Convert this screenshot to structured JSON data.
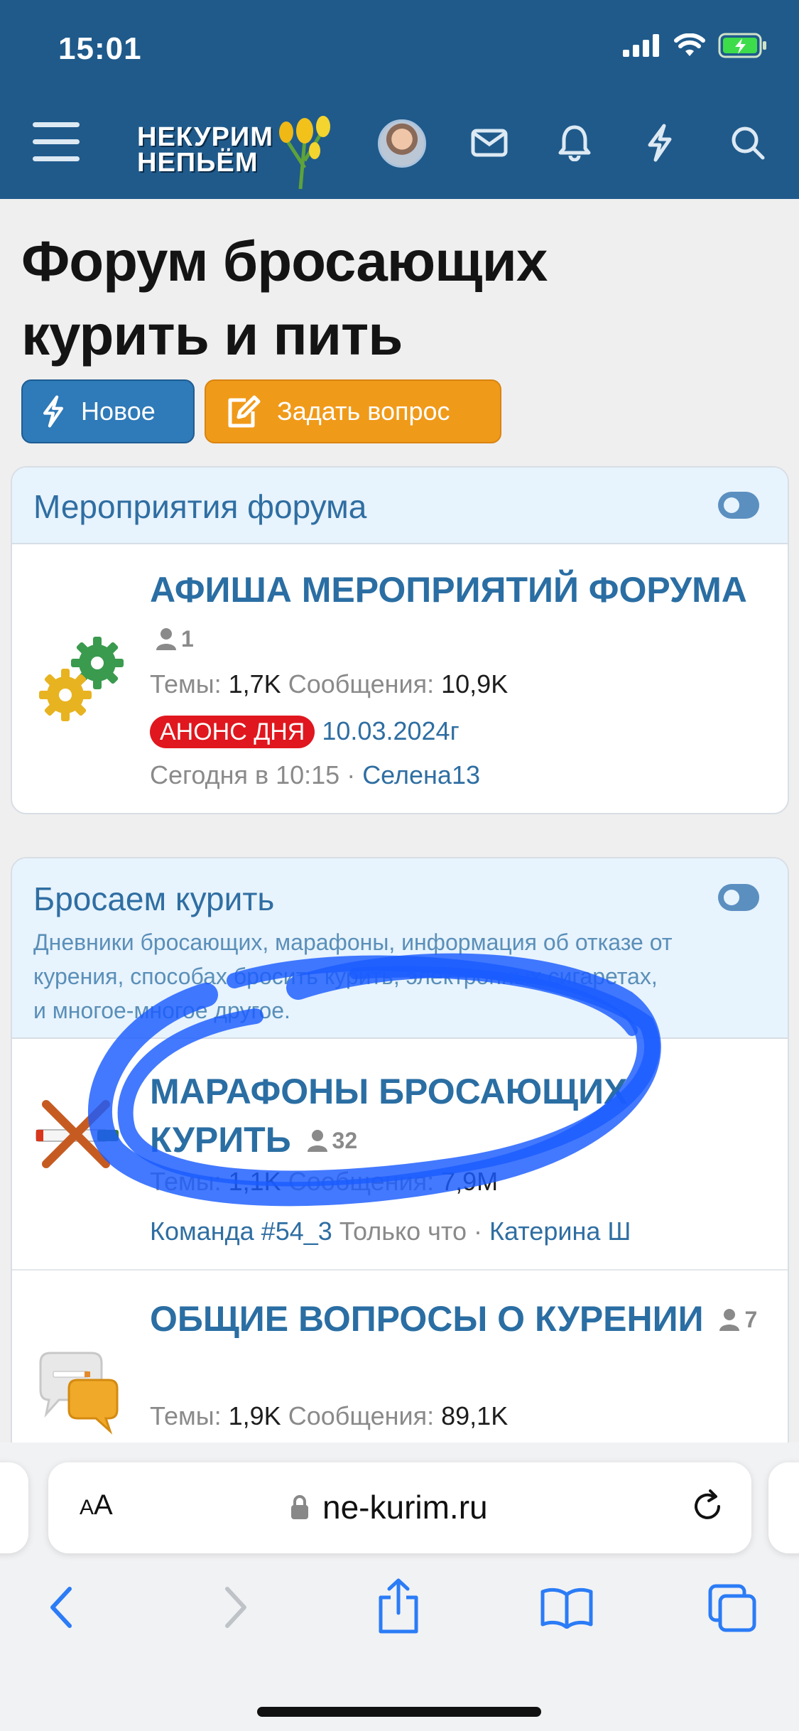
{
  "status": {
    "time": "15:01"
  },
  "header": {
    "logo_line1": "НЕКУРИМ",
    "logo_line2": "НЕПЬЁМ",
    "icons": [
      "menu-icon",
      "mail-icon",
      "bell-icon",
      "lightning-icon",
      "search-icon"
    ]
  },
  "page": {
    "title": "Форум бросающих курить и пить",
    "new_button": "Новое",
    "ask_button": "Задать вопрос"
  },
  "colors": {
    "header": "#1f5a8b",
    "link": "#2f6ea2",
    "ask": "#f09a1a",
    "new": "#2f7ab8",
    "badge": "#e0171e",
    "scribble": "#1a5cff"
  },
  "categories": [
    {
      "title": "Мероприятия форума",
      "nodes": [
        {
          "title": "АФИША МЕРОПРИЯТИЙ ФОРУМА",
          "users": "1",
          "threads_label": "Темы:",
          "threads": "1,7K",
          "messages_label": "Сообщения:",
          "messages": "10,9K",
          "badge": "АНОНС ДНЯ",
          "last_title": "10.03.2024г",
          "last_time": "Сегодня в 10:15",
          "last_user": "Селена13"
        }
      ]
    },
    {
      "title": "Бросаем курить",
      "description": "Дневники бросающих, марафоны, информация об отказе от курения, способах бросить курить, электронных сигаретах, и многое-многое другое.",
      "nodes": [
        {
          "title": "МАРАФОНЫ БРОСАЮЩИХ КУРИТЬ",
          "users": "32",
          "threads_label": "Темы:",
          "threads": "1,1K",
          "messages_label": "Сообщения:",
          "messages": "7,9M",
          "last_title": "Команда #54_3",
          "last_time": "Только что",
          "last_user": "Катерина Ш"
        },
        {
          "title": "ОБЩИЕ ВОПРОСЫ О КУРЕНИИ",
          "users": "7",
          "threads_label": "Темы:",
          "threads": "1,9K",
          "messages_label": "Сообщения:",
          "messages": "89,1K"
        }
      ]
    }
  ],
  "browser": {
    "aa_small": "A",
    "aa_large": "A",
    "url": "ne-kurim.ru",
    "toolbar": [
      "back-icon",
      "forward-icon",
      "share-icon",
      "bookmarks-icon",
      "tabs-icon"
    ]
  }
}
